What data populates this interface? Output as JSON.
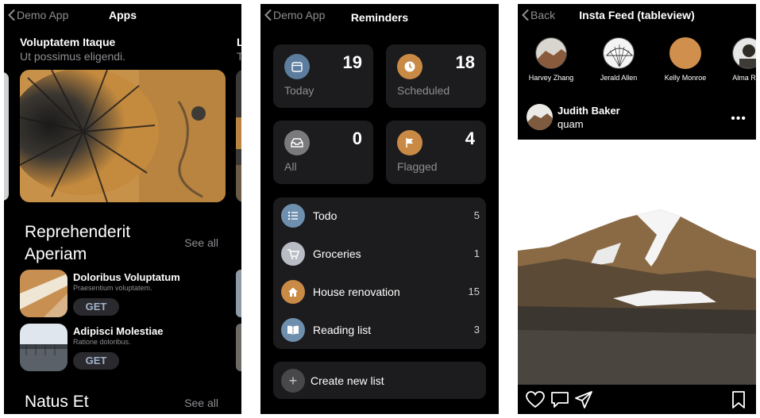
{
  "apps": {
    "back_label": "Demo App",
    "title": "Apps",
    "featured": [
      {
        "title": "Voluptatem Itaque",
        "subtitle": "Ut possimus eligendi."
      },
      {
        "title": "L",
        "subtitle": "T"
      }
    ],
    "sections": [
      {
        "title": "Reprehenderit Aperiam",
        "see_all": "See all",
        "apps": [
          {
            "name": "Doloribus Voluptatum",
            "desc": "Praesentium voluptatem.",
            "button": "GET"
          },
          {
            "name": "Adipisci Molestiae",
            "desc": "Ratione doloribus.",
            "button": "GET"
          }
        ]
      },
      {
        "title": "Natus Et",
        "see_all": "See all"
      }
    ]
  },
  "reminders": {
    "back_label": "Demo App",
    "title": "Reminders",
    "tiles": [
      {
        "label": "Today",
        "count": "19",
        "color": "#5c7d9e",
        "icon": "calendar-icon"
      },
      {
        "label": "Scheduled",
        "count": "18",
        "color": "#c98a45",
        "icon": "clock-icon"
      },
      {
        "label": "All",
        "count": "0",
        "color": "#7a7a7d",
        "icon": "tray-icon"
      },
      {
        "label": "Flagged",
        "count": "4",
        "color": "#c98a45",
        "icon": "flag-icon"
      }
    ],
    "lists": [
      {
        "name": "Todo",
        "count": "5",
        "color": "#6f8fae",
        "icon": "list-icon"
      },
      {
        "name": "Groceries",
        "count": "1",
        "color": "#b9bcc4",
        "icon": "cart-icon"
      },
      {
        "name": "House renovation",
        "count": "15",
        "color": "#c98a45",
        "icon": "house-icon"
      },
      {
        "name": "Reading list",
        "count": "3",
        "color": "#6f8fae",
        "icon": "book-icon"
      }
    ],
    "create_label": "Create new list"
  },
  "insta": {
    "back_label": "Back",
    "title": "Insta Feed (tableview)",
    "stories": [
      {
        "name": "Harvey Zhang"
      },
      {
        "name": "Jerald Allen"
      },
      {
        "name": "Kelly Monroe"
      },
      {
        "name": "Alma Rob"
      }
    ],
    "post": {
      "user": "Judith Baker",
      "subtitle": "quam",
      "more": "•••"
    }
  }
}
